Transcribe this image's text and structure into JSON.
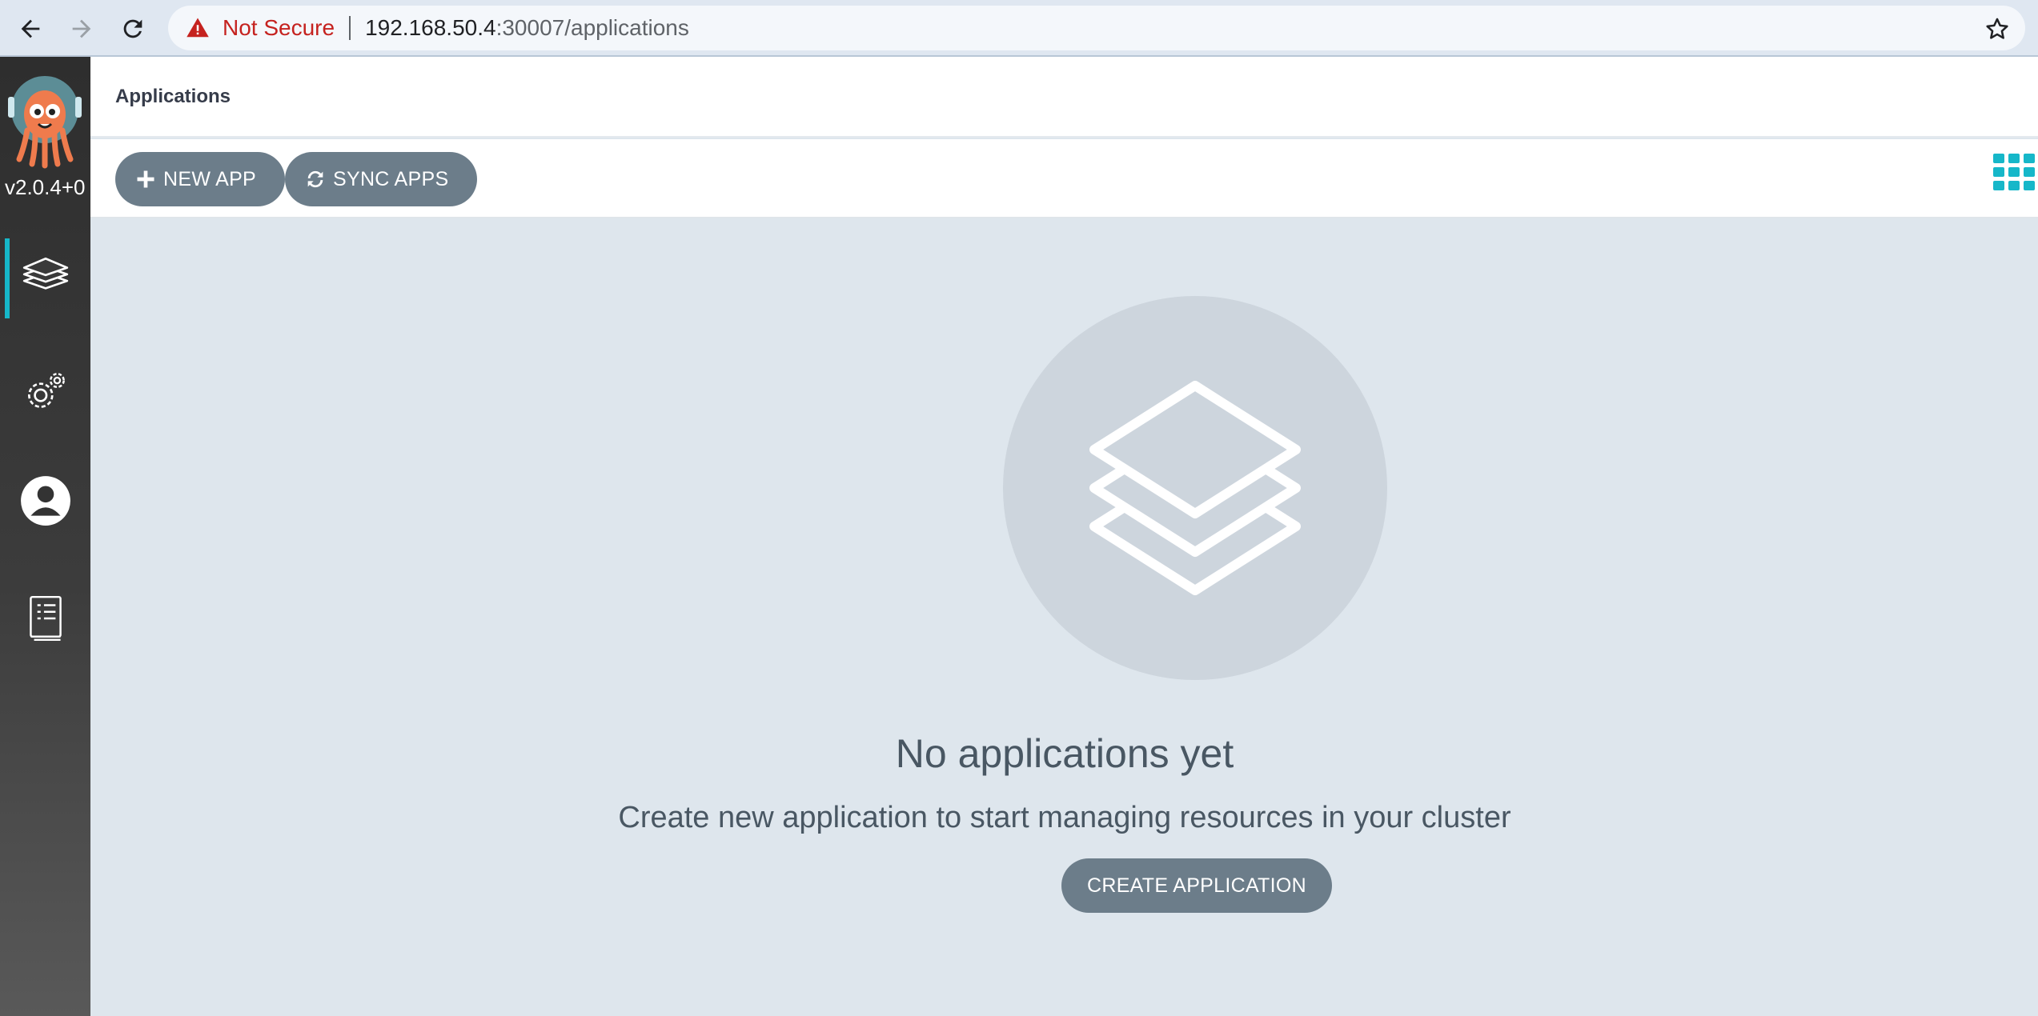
{
  "browser": {
    "security_label": "Not Secure",
    "url_host": "192.168.50.4",
    "url_path": ":30007/applications"
  },
  "sidebar": {
    "version": "v2.0.4+0",
    "items": [
      {
        "name": "applications",
        "icon": "layers-icon",
        "active": true
      },
      {
        "name": "settings",
        "icon": "gears-icon",
        "active": false
      },
      {
        "name": "user-info",
        "icon": "user-icon",
        "active": false
      },
      {
        "name": "docs",
        "icon": "docs-icon",
        "active": false
      }
    ]
  },
  "header": {
    "title": "Applications"
  },
  "toolbar": {
    "new_app_label": "NEW APP",
    "sync_apps_label": "SYNC APPS",
    "view_icon": "grid-view-icon"
  },
  "empty_state": {
    "title": "No applications yet",
    "subtitle": "Create new application to start managing resources in your cluster",
    "button_label": "CREATE APPLICATION"
  },
  "colors": {
    "accent": "#16b7c9",
    "button": "#6c7d8a",
    "warning": "#c5221f",
    "background": "#dee6ed"
  }
}
